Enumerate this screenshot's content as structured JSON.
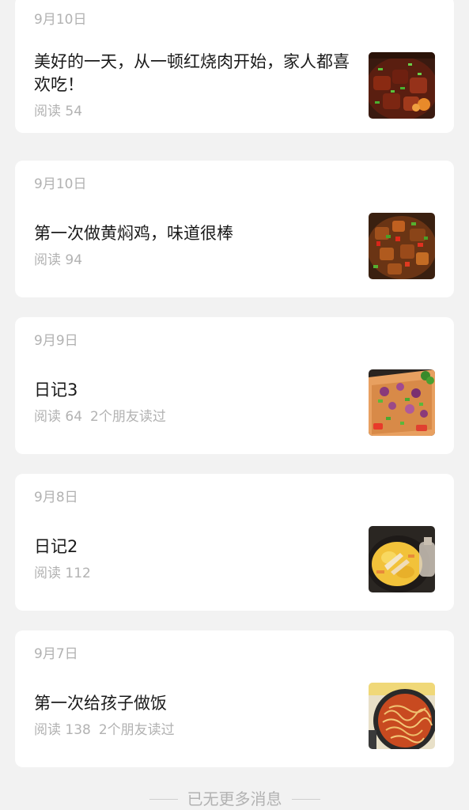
{
  "articles": [
    {
      "date": "9月10日",
      "title": "美好的一天，从一顿红烧肉开始，家人都喜欢吃！",
      "reads": "阅读 54",
      "friends": "",
      "thumb_icon": "braised-pork-photo"
    },
    {
      "date": "9月10日",
      "title": "第一次做黄焖鸡，味道很棒",
      "reads": "阅读 94",
      "friends": "",
      "thumb_icon": "braised-chicken-photo"
    },
    {
      "date": "9月9日",
      "title": "日记3",
      "reads": "阅读 64",
      "friends": "2个朋友读过",
      "thumb_icon": "flatbread-photo"
    },
    {
      "date": "9月8日",
      "title": "日记2",
      "reads": "阅读 112",
      "friends": "",
      "thumb_icon": "omelette-pan-photo"
    },
    {
      "date": "9月7日",
      "title": "第一次给孩子做饭",
      "reads": "阅读 138",
      "friends": "2个朋友读过",
      "thumb_icon": "noodle-pot-photo"
    }
  ],
  "footer": {
    "text": "已无更多消息"
  }
}
